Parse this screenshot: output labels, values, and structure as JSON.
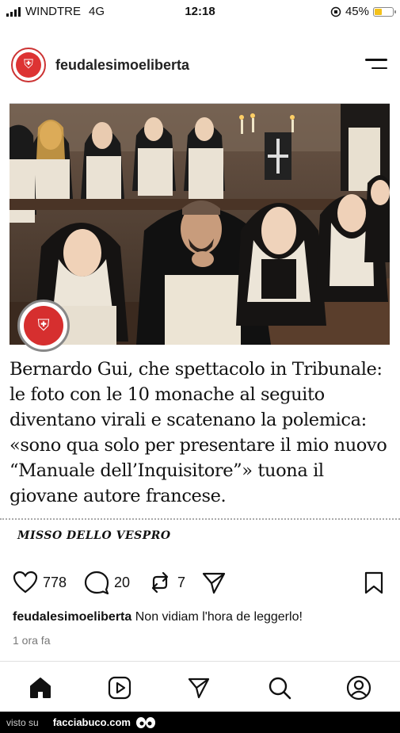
{
  "status_bar": {
    "carrier": "WINDTRE",
    "network": "4G",
    "time": "12:18",
    "battery": "45%",
    "battery_level": 0.45
  },
  "header": {
    "username": "feudalesimoeliberta",
    "avatar_icon": "knight-helmet-logo",
    "menu_icon": "hamburger-menu-icon"
  },
  "post": {
    "headline": "Bernardo Gui, che spettacolo in Tribunale: le foto con le 10 monache al seguito diventano virali e scatenano la polemica: «sono qua solo per presentare il mio nuovo “Manuale dell’Inquisitore”» tuona il giovane autore francese.",
    "author": "MISSO DELLO VESPRO",
    "likes": "778",
    "comments": "20",
    "reposts": "7",
    "caption_user": "feudalesimoeliberta",
    "caption_text": "Non vidiam l'hora de leggerlo!",
    "timestamp": "1 ora fa"
  },
  "footer": {
    "visto_su": "visto su",
    "site": "facciabuco.com"
  },
  "colors": {
    "accent_red": "#d62f2f",
    "battery_yellow": "#f4c21b",
    "footer_bg": "#000000"
  }
}
